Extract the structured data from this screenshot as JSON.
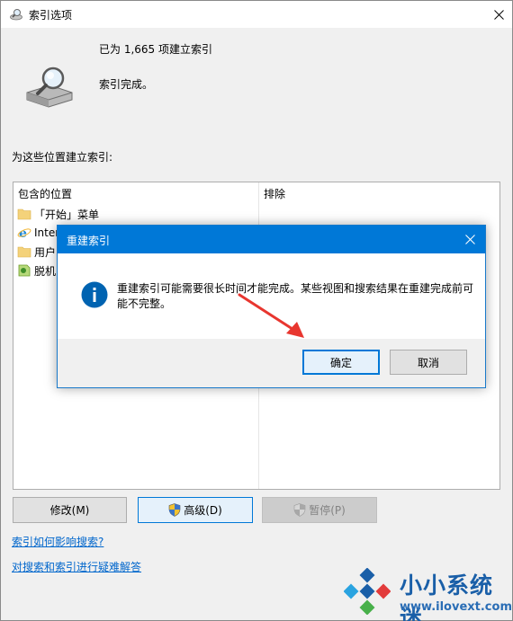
{
  "window": {
    "title": "索引选项",
    "status_count": "已为 1,665 项建立索引",
    "status_done": "索引完成。",
    "section_label": "为这些位置建立索引:"
  },
  "table": {
    "columns": {
      "included": "包含的位置",
      "excluded": "排除"
    },
    "rows": [
      {
        "icon": "folder-icon",
        "label": "「开始」菜单"
      },
      {
        "icon": "internet-explorer-icon",
        "label": "Inter"
      },
      {
        "icon": "folder-icon",
        "label": "用户"
      },
      {
        "icon": "offline-files-icon",
        "label": "脱机"
      }
    ]
  },
  "buttons": {
    "modify": "修改(M)",
    "advanced": "高级(D)",
    "pause": "暂停(P)"
  },
  "links": {
    "how_affects": "索引如何影响搜索?",
    "troubleshoot": "对搜索和索引进行疑难解答"
  },
  "dialog": {
    "title": "重建索引",
    "message": "重建索引可能需要很长时间才能完成。某些视图和搜索结果在重建完成前可能不完整。",
    "ok": "确定",
    "cancel": "取消"
  },
  "watermark": {
    "name": "小小系统迷",
    "url": "www.ilovext.com"
  },
  "colors": {
    "accent": "#0078d7",
    "link": "#0066cc",
    "arrow": "#e8362f"
  }
}
